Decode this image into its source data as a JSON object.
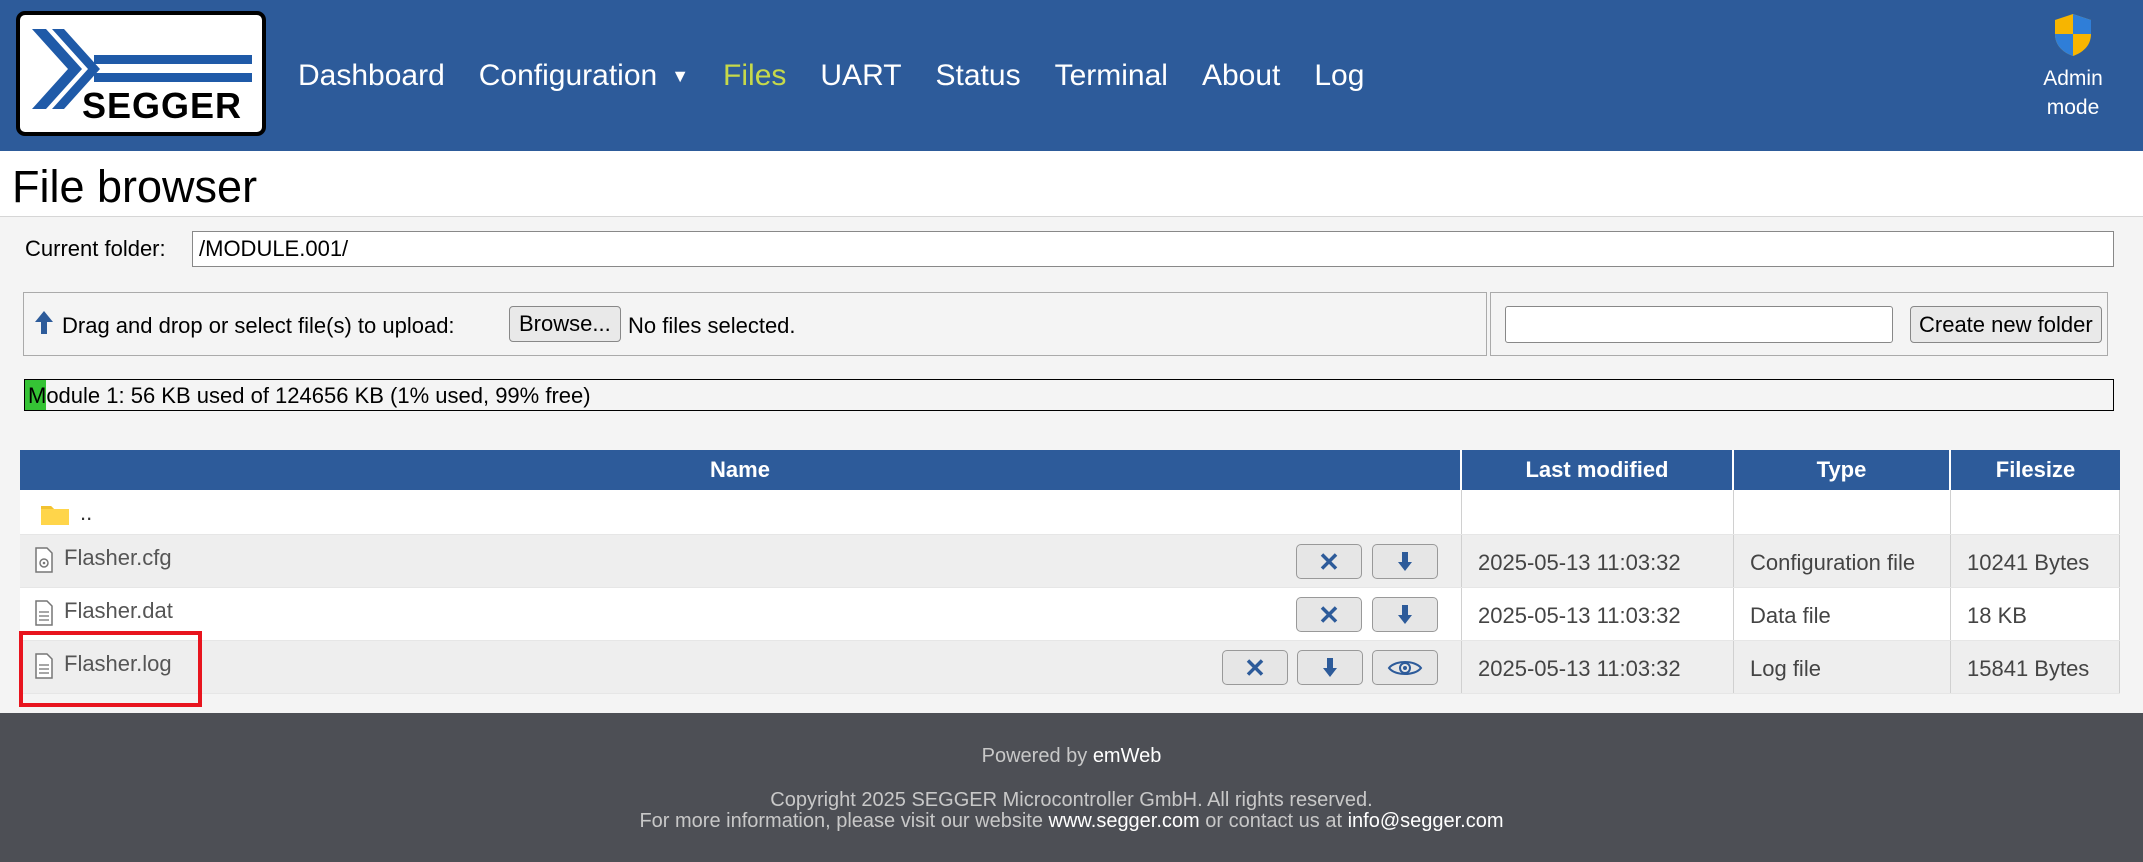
{
  "header": {
    "logo_text": "SEGGER",
    "nav": [
      "Dashboard",
      "Configuration",
      "Files",
      "UART",
      "Status",
      "Terminal",
      "About",
      "Log"
    ],
    "active_nav": "Files",
    "admin_line1": "Admin",
    "admin_line2": "mode"
  },
  "page_title": "File browser",
  "current_folder": {
    "label": "Current folder:",
    "value": "/MODULE.001/"
  },
  "upload": {
    "text": "Drag and drop or select file(s) to upload:",
    "browse_label": "Browse...",
    "no_files": "No files selected."
  },
  "new_folder": {
    "input_value": "",
    "button_label": "Create new folder"
  },
  "usage": {
    "text": "Module 1: 56 KB used of 124656 KB (1% used, 99% free)",
    "used_percent": 1
  },
  "table": {
    "headers": [
      "Name",
      "Last modified",
      "Type",
      "Filesize"
    ],
    "parent_dir": "..",
    "rows": [
      {
        "name": "Flasher.cfg",
        "modified": "2025-05-13 11:03:32",
        "type": "Configuration file",
        "size": "10241 Bytes"
      },
      {
        "name": "Flasher.dat",
        "modified": "2025-05-13 11:03:32",
        "type": "Data file",
        "size": "18 KB"
      },
      {
        "name": "Flasher.log",
        "modified": "2025-05-13 11:03:32",
        "type": "Log file",
        "size": "15841 Bytes"
      }
    ]
  },
  "footer": {
    "powered_prefix": "Powered by",
    "powered_name": "emWeb",
    "copyright": "Copyright 2025 SEGGER Microcontroller GmbH. All rights reserved.",
    "info_prefix": "For more information, please visit our website",
    "website": "www.segger.com",
    "info_middle": "or contact us at",
    "email": "info@segger.com"
  },
  "colors": {
    "header_bg": "#2d5b9a",
    "active_nav": "#c6d94a",
    "usage_fill": "#35c335",
    "highlight": "#e8141e",
    "footer_bg": "#4d4f55"
  }
}
